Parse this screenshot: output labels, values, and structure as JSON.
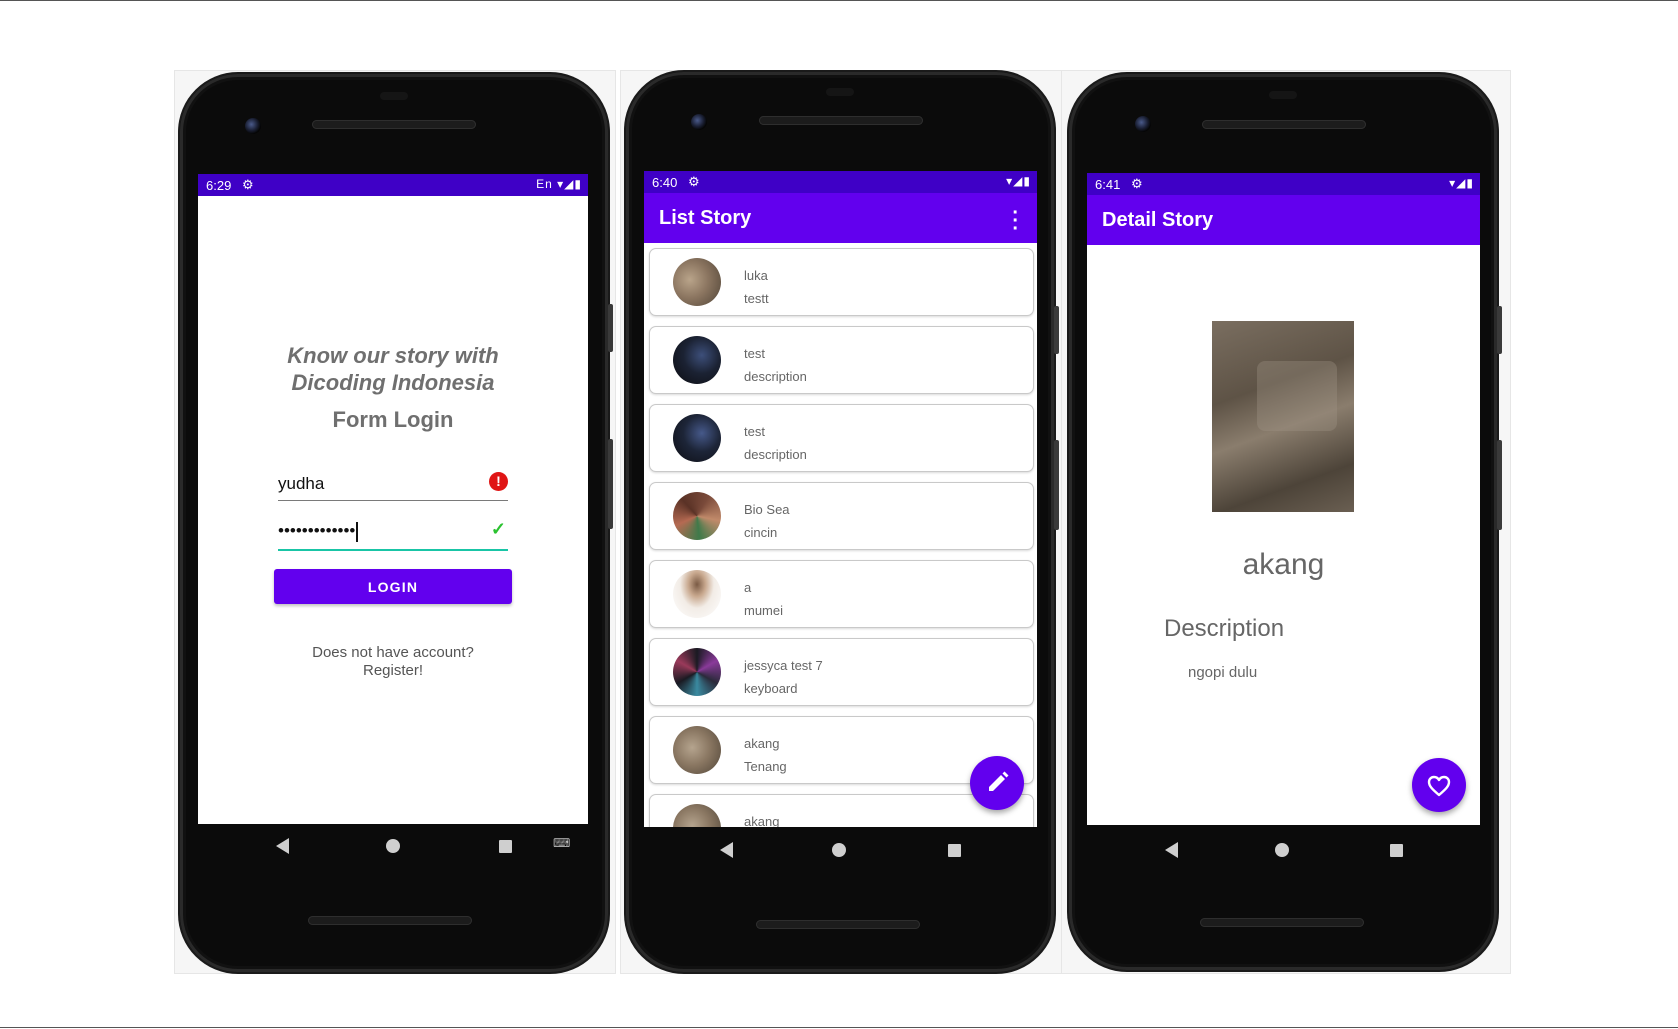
{
  "colors": {
    "status_bar": "#3f00c6",
    "primary": "#6200ee",
    "error": "#e01515",
    "valid": "#2bc230"
  },
  "login_screen": {
    "status": {
      "time": "6:29",
      "lang": "En"
    },
    "tagline": "Know our story with Dicoding Indonesia",
    "form_title": "Form Login",
    "username_value": "yudha",
    "password_value": "•••••••••••••",
    "login_label": "LOGIN",
    "register_line1": "Does not have account?",
    "register_line2": "Register!"
  },
  "list_screen": {
    "status": {
      "time": "6:40"
    },
    "title": "List Story",
    "stories": [
      {
        "name": "luka",
        "description": "testt"
      },
      {
        "name": "test",
        "description": "description"
      },
      {
        "name": "test",
        "description": "description"
      },
      {
        "name": "Bio Sea",
        "description": "cincin"
      },
      {
        "name": "a",
        "description": "mumei"
      },
      {
        "name": "jessyca test 7",
        "description": "keyboard"
      },
      {
        "name": "akang",
        "description": "Tenang"
      },
      {
        "name": "akang",
        "description": ""
      }
    ],
    "fab_icon": "pencil-icon"
  },
  "detail_screen": {
    "status": {
      "time": "6:41"
    },
    "title": "Detail Story",
    "name": "akang",
    "description_label": "Description",
    "description": "ngopi dulu",
    "fab_icon": "heart-icon"
  }
}
